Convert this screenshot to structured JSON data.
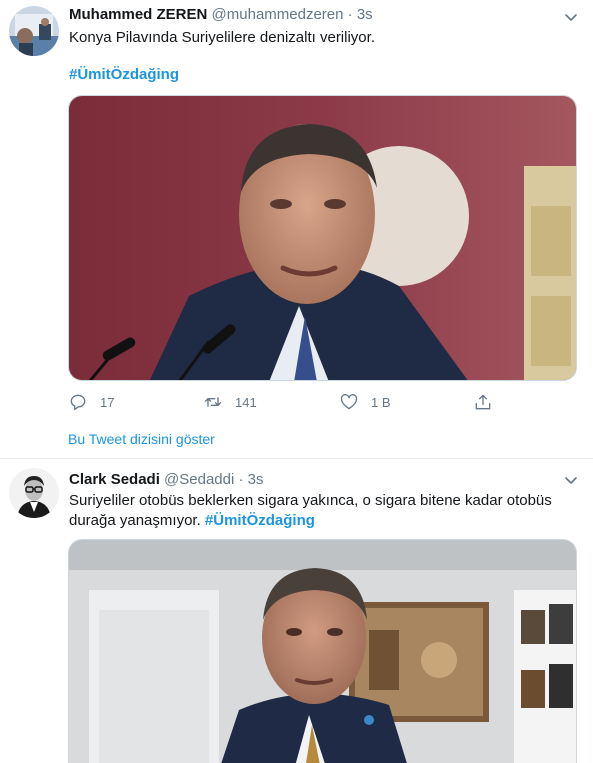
{
  "tweets": [
    {
      "name": "Muhammed ZEREN",
      "handle": "@muhammedzeren",
      "separator": "·",
      "time": "3s",
      "text": "Konya Pilavında Suriyelilere denizaltı veriliyor.",
      "hashtag": "#ÜmitÖzdağing",
      "counts": {
        "replies": "17",
        "retweets": "141",
        "likes": "1 B"
      },
      "thread_link": "Bu Tweet dizisini göster"
    },
    {
      "name": "Clark Sedadi",
      "handle": "@Sedaddi",
      "separator": "·",
      "time": "3s",
      "text": "Suriyeliler otobüs beklerken sigara yakınca, o sigara bitene kadar otobüs durağa yanaşmıyor.",
      "hashtag": "#ÜmitÖzdağing"
    }
  ],
  "colors": {
    "link": "#1b95e0",
    "secondary_text": "#657786",
    "border": "#e6ecf0"
  },
  "icons": [
    "reply-icon",
    "retweet-icon",
    "like-icon",
    "share-icon",
    "chevron-down-icon"
  ]
}
